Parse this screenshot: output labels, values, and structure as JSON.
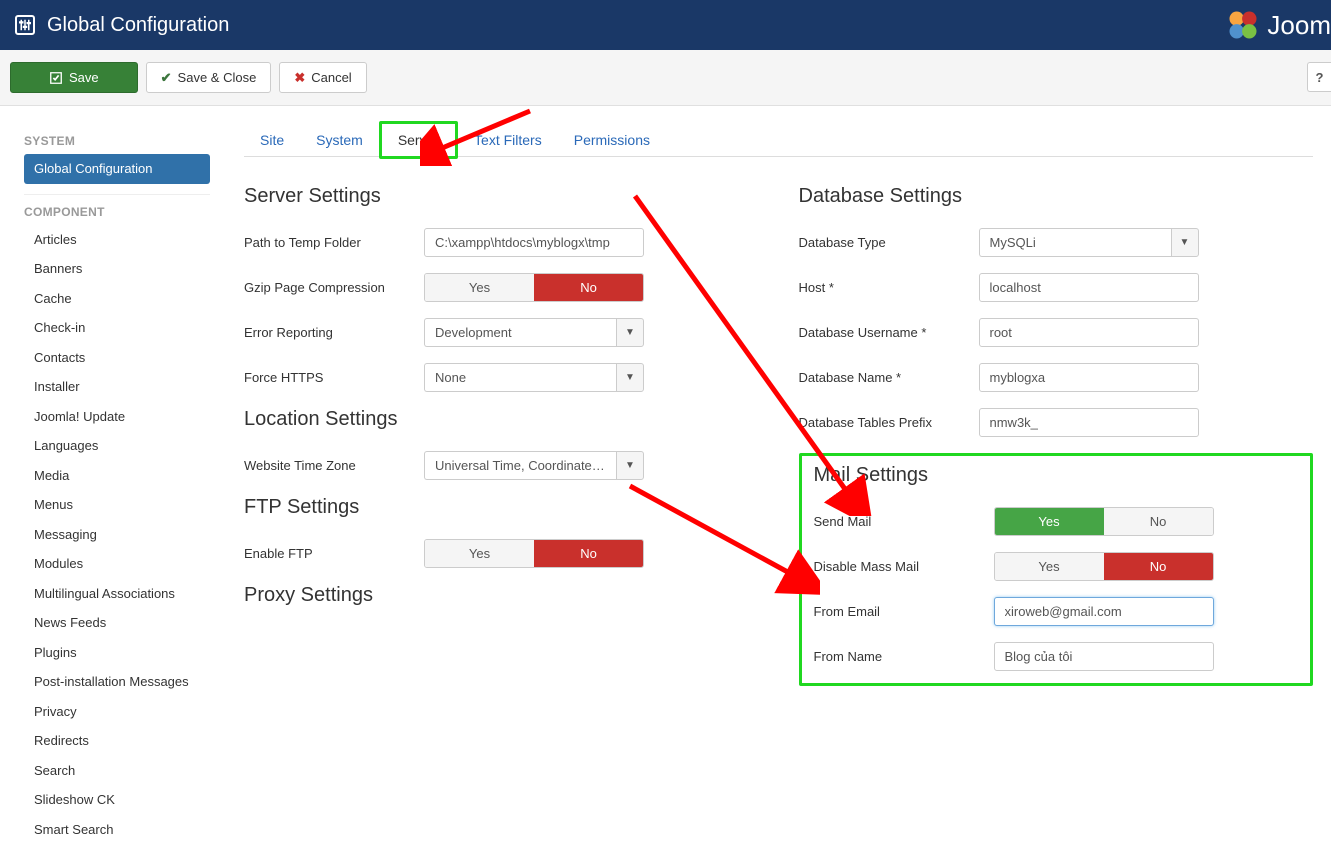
{
  "header": {
    "title": "Global Configuration",
    "brand": "Joom"
  },
  "toolbar": {
    "save": "Save",
    "save_close": "Save & Close",
    "cancel": "Cancel"
  },
  "sidebar": {
    "system_label": "SYSTEM",
    "component_label": "COMPONENT",
    "global_config": "Global Configuration",
    "items": [
      "Articles",
      "Banners",
      "Cache",
      "Check-in",
      "Contacts",
      "Installer",
      "Joomla! Update",
      "Languages",
      "Media",
      "Menus",
      "Messaging",
      "Modules",
      "Multilingual Associations",
      "News Feeds",
      "Plugins",
      "Post-installation Messages",
      "Privacy",
      "Redirects",
      "Search",
      "Slideshow CK",
      "Smart Search"
    ]
  },
  "tabs": {
    "site": "Site",
    "system": "System",
    "server": "Server",
    "text_filters": "Text Filters",
    "permissions": "Permissions"
  },
  "server": {
    "title": "Server Settings",
    "tmp_label": "Path to Temp Folder",
    "tmp_value": "C:\\xampp\\htdocs\\myblogx\\tmp",
    "gzip_label": "Gzip Page Compression",
    "error_label": "Error Reporting",
    "error_value": "Development",
    "https_label": "Force HTTPS",
    "https_value": "None"
  },
  "location": {
    "title": "Location Settings",
    "tz_label": "Website Time Zone",
    "tz_value": "Universal Time, Coordinated ..."
  },
  "ftp": {
    "title": "FTP Settings",
    "enable_label": "Enable FTP"
  },
  "proxy": {
    "title": "Proxy Settings"
  },
  "db": {
    "title": "Database Settings",
    "type_label": "Database Type",
    "type_value": "MySQLi",
    "host_label": "Host *",
    "host_value": "localhost",
    "user_label": "Database Username *",
    "user_value": "root",
    "name_label": "Database Name *",
    "name_value": "myblogxa",
    "prefix_label": "Database Tables Prefix",
    "prefix_value": "nmw3k_"
  },
  "mail": {
    "title": "Mail Settings",
    "send_label": "Send Mail",
    "disable_label": "Disable Mass Mail",
    "from_email_label": "From Email",
    "from_email_value": "xiroweb@gmail.com",
    "from_name_label": "From Name",
    "from_name_value": "Blog của tôi"
  },
  "yn": {
    "yes": "Yes",
    "no": "No"
  }
}
